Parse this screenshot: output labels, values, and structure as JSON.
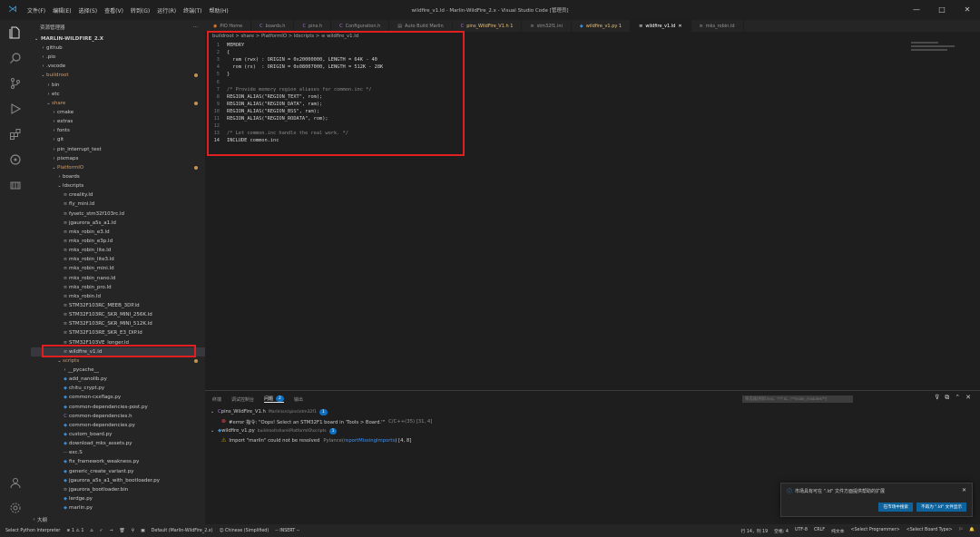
{
  "titlebar": {
    "menus": [
      "文件(F)",
      "编辑(E)",
      "选择(S)",
      "查看(V)",
      "转到(G)",
      "运行(R)",
      "终端(T)",
      "帮助(H)"
    ],
    "title": "wildfire_v1.ld - Marlin-WildFire_2.x - Visual Studio Code [管理员]",
    "minimize": "—",
    "maximize": "□",
    "close": "✕"
  },
  "sidebar": {
    "header": "资源管理器",
    "header_more": "···",
    "root": "MARLIN-WILDFIRE_2.X",
    "items": [
      {
        "label": "github",
        "depth": 1,
        "type": "folder",
        "open": false
      },
      {
        "label": ".pio",
        "depth": 1,
        "type": "folder",
        "open": false
      },
      {
        "label": ".vscode",
        "depth": 1,
        "type": "folder",
        "open": false
      },
      {
        "label": "buildroot",
        "depth": 1,
        "type": "folder",
        "open": true,
        "git": true
      },
      {
        "label": "bin",
        "depth": 2,
        "type": "folder",
        "open": false
      },
      {
        "label": "etc",
        "depth": 2,
        "type": "folder",
        "open": false
      },
      {
        "label": "share",
        "depth": 2,
        "type": "folder",
        "open": true,
        "git": true
      },
      {
        "label": "cmake",
        "depth": 3,
        "type": "folder",
        "open": false
      },
      {
        "label": "extras",
        "depth": 3,
        "type": "folder",
        "open": false
      },
      {
        "label": "fonts",
        "depth": 3,
        "type": "folder",
        "open": false
      },
      {
        "label": "git",
        "depth": 3,
        "type": "folder",
        "open": false
      },
      {
        "label": "pin_interrupt_test",
        "depth": 3,
        "type": "folder",
        "open": false
      },
      {
        "label": "pixmaps",
        "depth": 3,
        "type": "folder",
        "open": false
      },
      {
        "label": "PlatformIO",
        "depth": 3,
        "type": "folder",
        "open": true,
        "git": true
      },
      {
        "label": "boards",
        "depth": 4,
        "type": "folder",
        "open": false
      },
      {
        "label": "ldscripts",
        "depth": 4,
        "type": "folder",
        "open": true
      },
      {
        "label": "creality.ld",
        "depth": 5,
        "type": "ld"
      },
      {
        "label": "fly_mini.ld",
        "depth": 5,
        "type": "ld"
      },
      {
        "label": "fysetc_stm32f103rc.ld",
        "depth": 5,
        "type": "ld"
      },
      {
        "label": "jgaurora_a5s_a1.ld",
        "depth": 5,
        "type": "ld"
      },
      {
        "label": "mks_robin_e3.ld",
        "depth": 5,
        "type": "ld"
      },
      {
        "label": "mks_robin_e3p.ld",
        "depth": 5,
        "type": "ld"
      },
      {
        "label": "mks_robin_lite.ld",
        "depth": 5,
        "type": "ld"
      },
      {
        "label": "mks_robin_lite3.ld",
        "depth": 5,
        "type": "ld"
      },
      {
        "label": "mks_robin_mini.ld",
        "depth": 5,
        "type": "ld"
      },
      {
        "label": "mks_robin_nano.ld",
        "depth": 5,
        "type": "ld"
      },
      {
        "label": "mks_robin_pro.ld",
        "depth": 5,
        "type": "ld"
      },
      {
        "label": "mks_robin.ld",
        "depth": 5,
        "type": "ld"
      },
      {
        "label": "STM32F103RC_MEEB_3DP.ld",
        "depth": 5,
        "type": "ld"
      },
      {
        "label": "STM32F103RC_SKR_MINI_256K.ld",
        "depth": 5,
        "type": "ld"
      },
      {
        "label": "STM32F103RC_SKR_MINI_512K.ld",
        "depth": 5,
        "type": "ld"
      },
      {
        "label": "STM32F103RE_SKR_E3_DIP.ld",
        "depth": 5,
        "type": "ld"
      },
      {
        "label": "STM32F103VE_longer.ld",
        "depth": 5,
        "type": "ld"
      },
      {
        "label": "wildfire_v1.ld",
        "depth": 5,
        "type": "ld",
        "selected": true
      },
      {
        "label": "scripts",
        "depth": 4,
        "type": "folder",
        "open": true,
        "git": true
      },
      {
        "label": "__pycache__",
        "depth": 5,
        "type": "folder",
        "open": false
      },
      {
        "label": "add_nanolib.py",
        "depth": 5,
        "type": "py"
      },
      {
        "label": "chitu_crypt.py",
        "depth": 5,
        "type": "py"
      },
      {
        "label": "common-cxxflags.py",
        "depth": 5,
        "type": "py"
      },
      {
        "label": "common-dependencies-post.py",
        "depth": 5,
        "type": "py"
      },
      {
        "label": "common-dependencies.h",
        "depth": 5,
        "type": "h"
      },
      {
        "label": "common-dependencies.py",
        "depth": 5,
        "type": "py"
      },
      {
        "label": "custom_board.py",
        "depth": 5,
        "type": "py"
      },
      {
        "label": "download_mks_assets.py",
        "depth": 5,
        "type": "py"
      },
      {
        "label": "exc.S",
        "depth": 5,
        "type": "asm"
      },
      {
        "label": "fix_framework_weakness.py",
        "depth": 5,
        "type": "py"
      },
      {
        "label": "generic_create_variant.py",
        "depth": 5,
        "type": "py"
      },
      {
        "label": "jgaurora_a5s_a1_with_bootloader.py",
        "depth": 5,
        "type": "py"
      },
      {
        "label": "jgaurora_bootloader.bin",
        "depth": 5,
        "type": "ld"
      },
      {
        "label": "lerdge.py",
        "depth": 5,
        "type": "py"
      },
      {
        "label": "marlin.py",
        "depth": 5,
        "type": "py"
      }
    ],
    "outline": "大纲"
  },
  "tabs": [
    {
      "label": "PIO Home",
      "icon": "pio-icon",
      "glyph": "◉"
    },
    {
      "label": "boards.h",
      "icon": "c-icon",
      "glyph": "C"
    },
    {
      "label": "pins.h",
      "icon": "c-icon",
      "glyph": "C"
    },
    {
      "label": "Configuration.h",
      "icon": "c-icon",
      "glyph": "C"
    },
    {
      "label": "Auto Build Marlin",
      "icon": "build-icon",
      "glyph": "▤"
    },
    {
      "label": "pins_WildFire_V1.h 1",
      "icon": "c-icon",
      "glyph": "C",
      "modified": true
    },
    {
      "label": "stm32f1.ini",
      "icon": "file-icon",
      "glyph": "≡"
    },
    {
      "label": "wildfire_v1.py 1",
      "icon": "python-icon",
      "glyph": "◆",
      "modified": true
    },
    {
      "label": "wildfire_v1.ld",
      "icon": "file-icon",
      "glyph": "≡",
      "active": true
    },
    {
      "label": "mks_robin.ld",
      "icon": "file-icon",
      "glyph": "≡"
    }
  ],
  "breadcrumb": "buildroot > share > PlatformIO > ldscripts > ≡ wildfire_v1.ld",
  "code": [
    {
      "n": "1",
      "text": "MEMORY"
    },
    {
      "n": "2",
      "text": "{"
    },
    {
      "n": "3",
      "text": "  ram (rwx) : ORIGIN = 0x20000000, LENGTH = 64K - 40"
    },
    {
      "n": "4",
      "text": "  rom (rx)  : ORIGIN = 0x08007000, LENGTH = 512K - 28K"
    },
    {
      "n": "5",
      "text": "}"
    },
    {
      "n": "6",
      "text": ""
    },
    {
      "n": "7",
      "text": "/* Provide memory region aliases for common.inc */"
    },
    {
      "n": "8",
      "text": "REGION_ALIAS(\"REGION_TEXT\", rom);"
    },
    {
      "n": "9",
      "text": "REGION_ALIAS(\"REGION_DATA\", ram);"
    },
    {
      "n": "10",
      "text": "REGION_ALIAS(\"REGION_BSS\", ram);"
    },
    {
      "n": "11",
      "text": "REGION_ALIAS(\"REGION_RODATA\", rom);"
    },
    {
      "n": "12",
      "text": ""
    },
    {
      "n": "13",
      "text": "/* Let common.inc handle the real work. */"
    },
    {
      "n": "14",
      "text": "INCLUDE common.inc"
    }
  ],
  "panel": {
    "tabs": [
      {
        "label": "终端"
      },
      {
        "label": "调试控制台"
      },
      {
        "label": "问题",
        "badge": "2",
        "active": true
      },
      {
        "label": "输出"
      }
    ],
    "filter_placeholder": "筛选器(例如 text、**/*.ts、!**/node_modules/**)",
    "actions": {
      "filter": "⊽",
      "copy": "⧉",
      "collapse": "⌃",
      "close": "✕"
    },
    "problems": [
      {
        "kind": "file",
        "label": "pins_WildFire_V1.h",
        "path": "Marlin\\src\\pins\\stm32f1",
        "count": "1"
      },
      {
        "kind": "error",
        "label": "#error 指令: \"Oops! Select an STM32F1 board in 'Tools > Board.'\"",
        "src": "C/C++(35) [31, 4]"
      },
      {
        "kind": "file",
        "label": "wildfire_v1.py",
        "path": "buildroot\\share\\PlatformIO\\scripts",
        "count": "1"
      },
      {
        "kind": "warning",
        "label": "Import \"marlin\" could not be resolved",
        "src_prefix": "Pylance(",
        "src_link": "reportMissingImports",
        "src_suffix": ") [4, 8]"
      }
    ]
  },
  "notification": {
    "message": "市场具有可在 \".ld\" 文件方面提供帮助的扩展",
    "btn_search": "在市场中搜索",
    "btn_no": "不再为 \".ld\" 文件显示",
    "close": "✕"
  },
  "statusbar": {
    "left": [
      "Select Python Interpreter",
      "⊗ 1 ⚠ 1",
      "⌂",
      "✓",
      "→",
      "🗑",
      "⚲",
      "▣",
      "Default (Marlin-WildFire_2.x)",
      "☺ Chinese (Simplified)",
      "-- INSERT --"
    ],
    "right": [
      "行 14，列 19",
      "空格: 4",
      "UTF-8",
      "CRLF",
      "纯文本",
      "<Select Programmer>",
      "<Select Board Type>",
      "⚐",
      "🔔"
    ]
  },
  "colors": {
    "highlight": "#e02020",
    "accent": "#0e70c0",
    "error": "#f14c4c",
    "warning": "#cca700"
  }
}
